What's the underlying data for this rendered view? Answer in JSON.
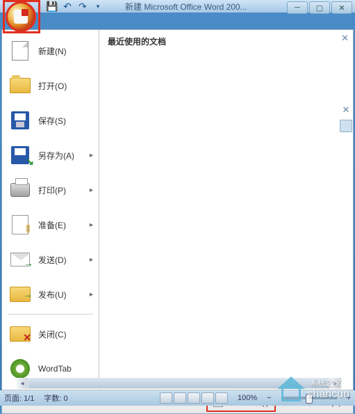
{
  "titlebar": {
    "title": "新建 Microsoft Office Word 200..."
  },
  "menu": {
    "items": [
      {
        "label": "新建(N)",
        "icon": "new"
      },
      {
        "label": "打开(O)",
        "icon": "open"
      },
      {
        "label": "保存(S)",
        "icon": "save"
      },
      {
        "label": "另存为(A)",
        "icon": "saveas",
        "arrow": true
      },
      {
        "label": "打印(P)",
        "icon": "print",
        "arrow": true
      },
      {
        "label": "准备(E)",
        "icon": "prep",
        "arrow": true
      },
      {
        "label": "发送(D)",
        "icon": "send",
        "arrow": true
      },
      {
        "label": "发布(U)",
        "icon": "publish",
        "arrow": true
      },
      {
        "label": "关闭(C)",
        "icon": "close"
      },
      {
        "label": "WordTab",
        "icon": "wordtab"
      }
    ],
    "recent_title": "最近使用的文档",
    "footer": {
      "options": "Word 选项(I)",
      "exit": "退出 Word(X)"
    }
  },
  "statusbar": {
    "page": "页面: 1/1",
    "words": "字数: 0",
    "zoom": "100%",
    "zoom_minus": "−",
    "zoom_plus": "+"
  },
  "watermark": {
    "cn": "系统之家",
    "en": "shancun"
  }
}
